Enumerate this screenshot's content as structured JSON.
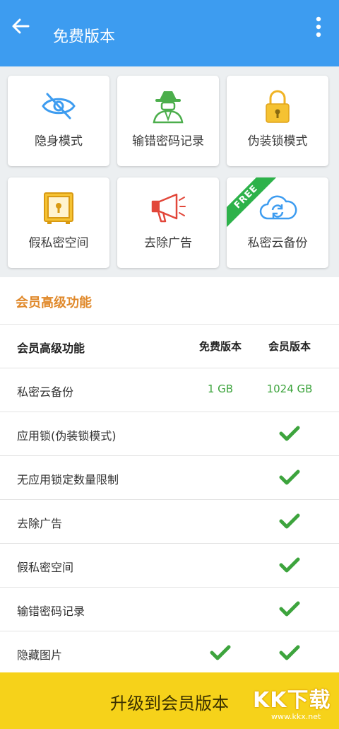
{
  "topbar": {
    "title": "免费版本"
  },
  "features": [
    {
      "label": "隐身模式",
      "icon": "hidden-eye-icon"
    },
    {
      "label": "输错密码记录",
      "icon": "spy-icon"
    },
    {
      "label": "伪装锁模式",
      "icon": "padlock-icon"
    },
    {
      "label": "假私密空间",
      "icon": "safe-icon"
    },
    {
      "label": "去除广告",
      "icon": "megaphone-icon"
    },
    {
      "label": "私密云备份",
      "icon": "cloud-sync-icon",
      "badge": "FREE"
    }
  ],
  "section": {
    "title": "会员高级功能",
    "header": {
      "name": "会员高级功能",
      "free": "免费版本",
      "vip": "会员版本"
    },
    "rows": [
      {
        "name": "私密云备份",
        "free": "1 GB",
        "vip": "1024 GB"
      },
      {
        "name": "应用锁(伪装锁模式)",
        "free": "",
        "vip": "check"
      },
      {
        "name": "无应用锁定数量限制",
        "free": "",
        "vip": "check"
      },
      {
        "name": "去除广告",
        "free": "",
        "vip": "check"
      },
      {
        "name": "假私密空间",
        "free": "",
        "vip": "check"
      },
      {
        "name": "输错密码记录",
        "free": "",
        "vip": "check"
      },
      {
        "name": "隐藏图片",
        "free": "check",
        "vip": "check"
      }
    ]
  },
  "upgrade": {
    "label": "升级到会员版本"
  },
  "watermark": {
    "text": "KK下载",
    "url": "www.kkx.net"
  },
  "colors": {
    "accent": "#3d9cf0",
    "section_title": "#e0892b",
    "check": "#3da43d",
    "upgrade_bg": "#f6d21a"
  }
}
